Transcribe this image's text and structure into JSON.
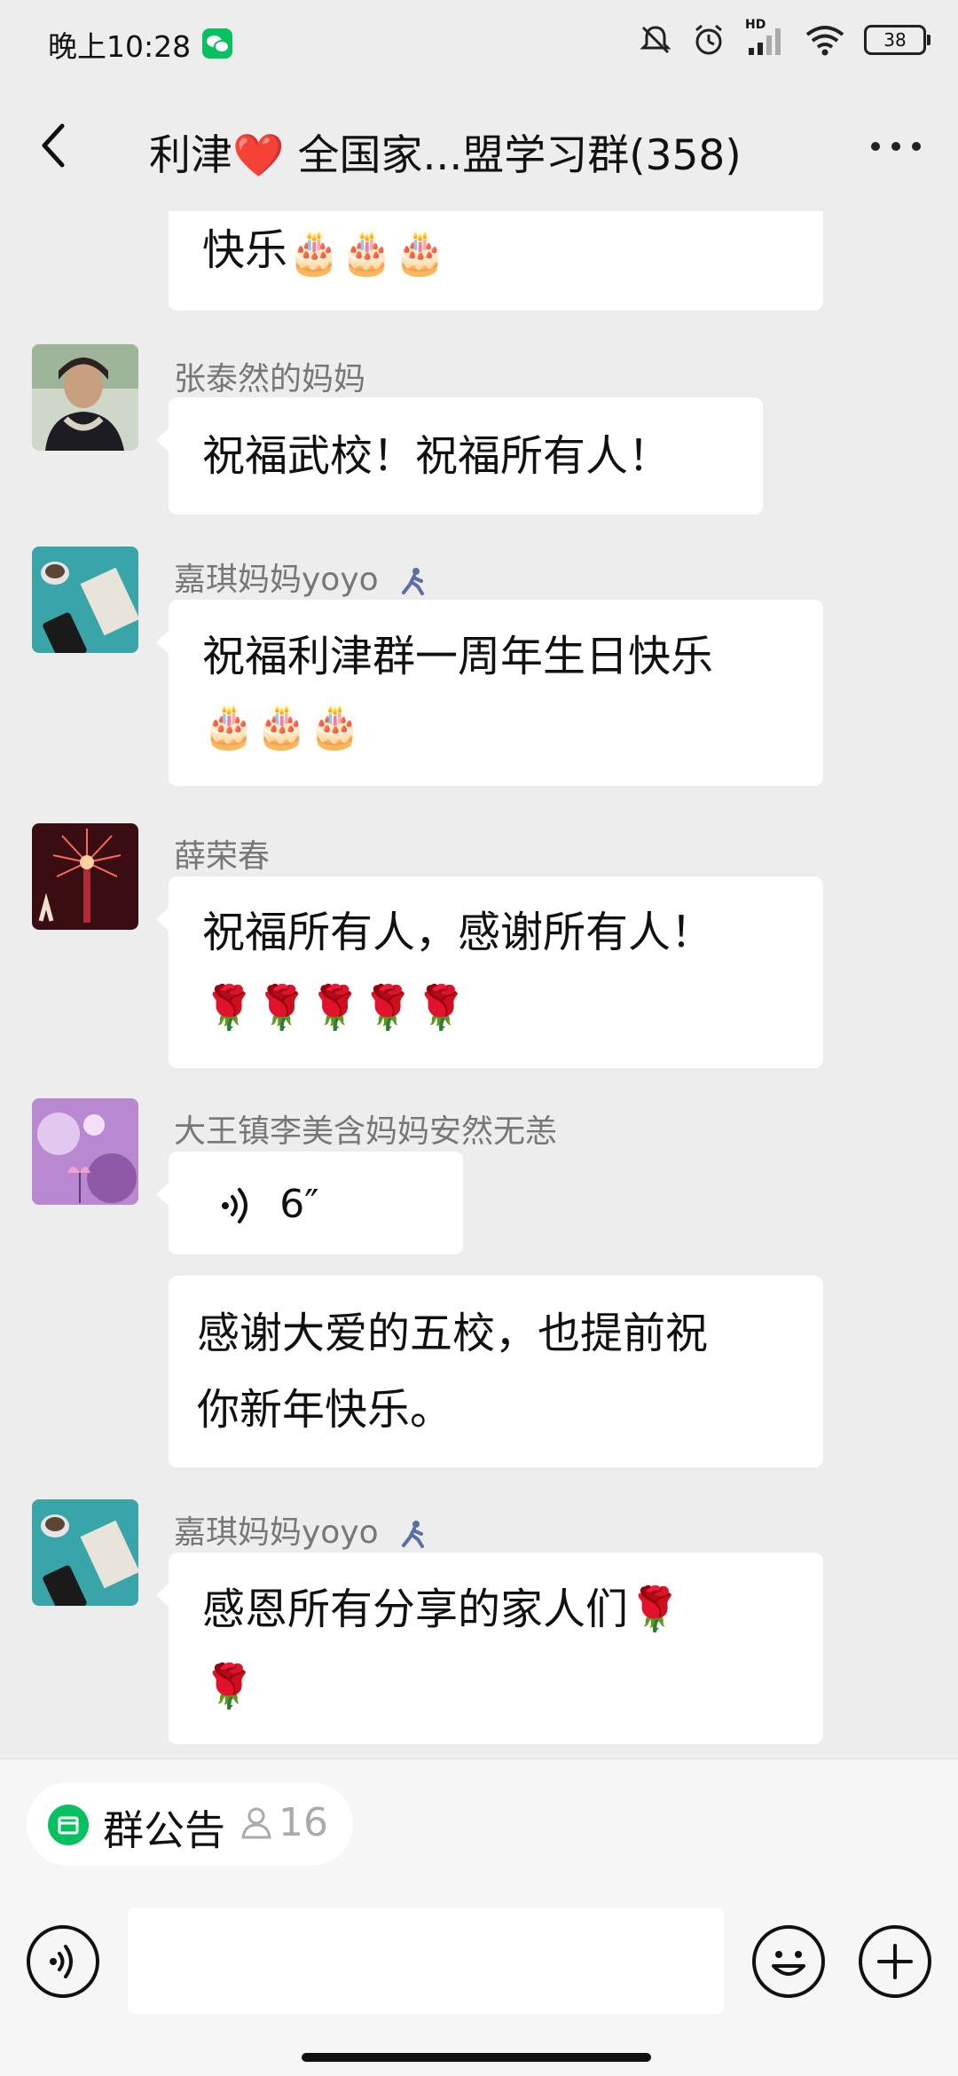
{
  "status_bar": {
    "time": "晚上10:28",
    "battery": "38",
    "network_badge": "HD"
  },
  "header": {
    "title": "利津❤️ 全国家...盟学习群(358)"
  },
  "messages": [
    {
      "id": "m0",
      "sender": "",
      "text": "快乐🎂🎂🎂",
      "partial": true
    },
    {
      "id": "m1",
      "sender": "张泰然的妈妈",
      "text": "祝福武校！祝福所有人！"
    },
    {
      "id": "m2",
      "sender": "嘉琪妈妈yoyo",
      "text": "祝福利津群一周年生日快乐🎂🎂🎂",
      "sender_badge_icon": "walker-icon"
    },
    {
      "id": "m3",
      "sender": "薛荣春",
      "text": "祝福所有人，感谢所有人！🌹🌹🌹🌹🌹"
    },
    {
      "id": "m4",
      "sender": "大王镇李美含妈妈安然无恙",
      "voice_duration": "6″",
      "text": "感谢大爱的五校，也提前祝你新年快乐。"
    },
    {
      "id": "m5",
      "sender": "嘉琪妈妈yoyo",
      "text": "感恩所有分享的家人们🌹🌹",
      "sender_badge_icon": "walker-icon"
    }
  ],
  "messages_display": {
    "m0": [
      "快乐",
      "🎂🎂🎂"
    ],
    "m2": [
      "祝福利津群一周年生日快乐",
      "🎂🎂🎂"
    ],
    "m3": [
      "祝福所有人，感谢所有人！",
      "🌹🌹🌹🌹🌹"
    ],
    "m4_line1": "感谢大爱的五校，也提前祝",
    "m4_line2": "你新年快乐。",
    "m5_line1": "感恩所有分享的家人们🌹",
    "m5_line2": "🌹"
  },
  "announcement": {
    "label": "群公告",
    "member_count": "16"
  },
  "composer": {
    "value": "",
    "placeholder": ""
  },
  "colors": {
    "accent": "#07c160",
    "background": "#ededed",
    "bubble": "#ffffff"
  }
}
